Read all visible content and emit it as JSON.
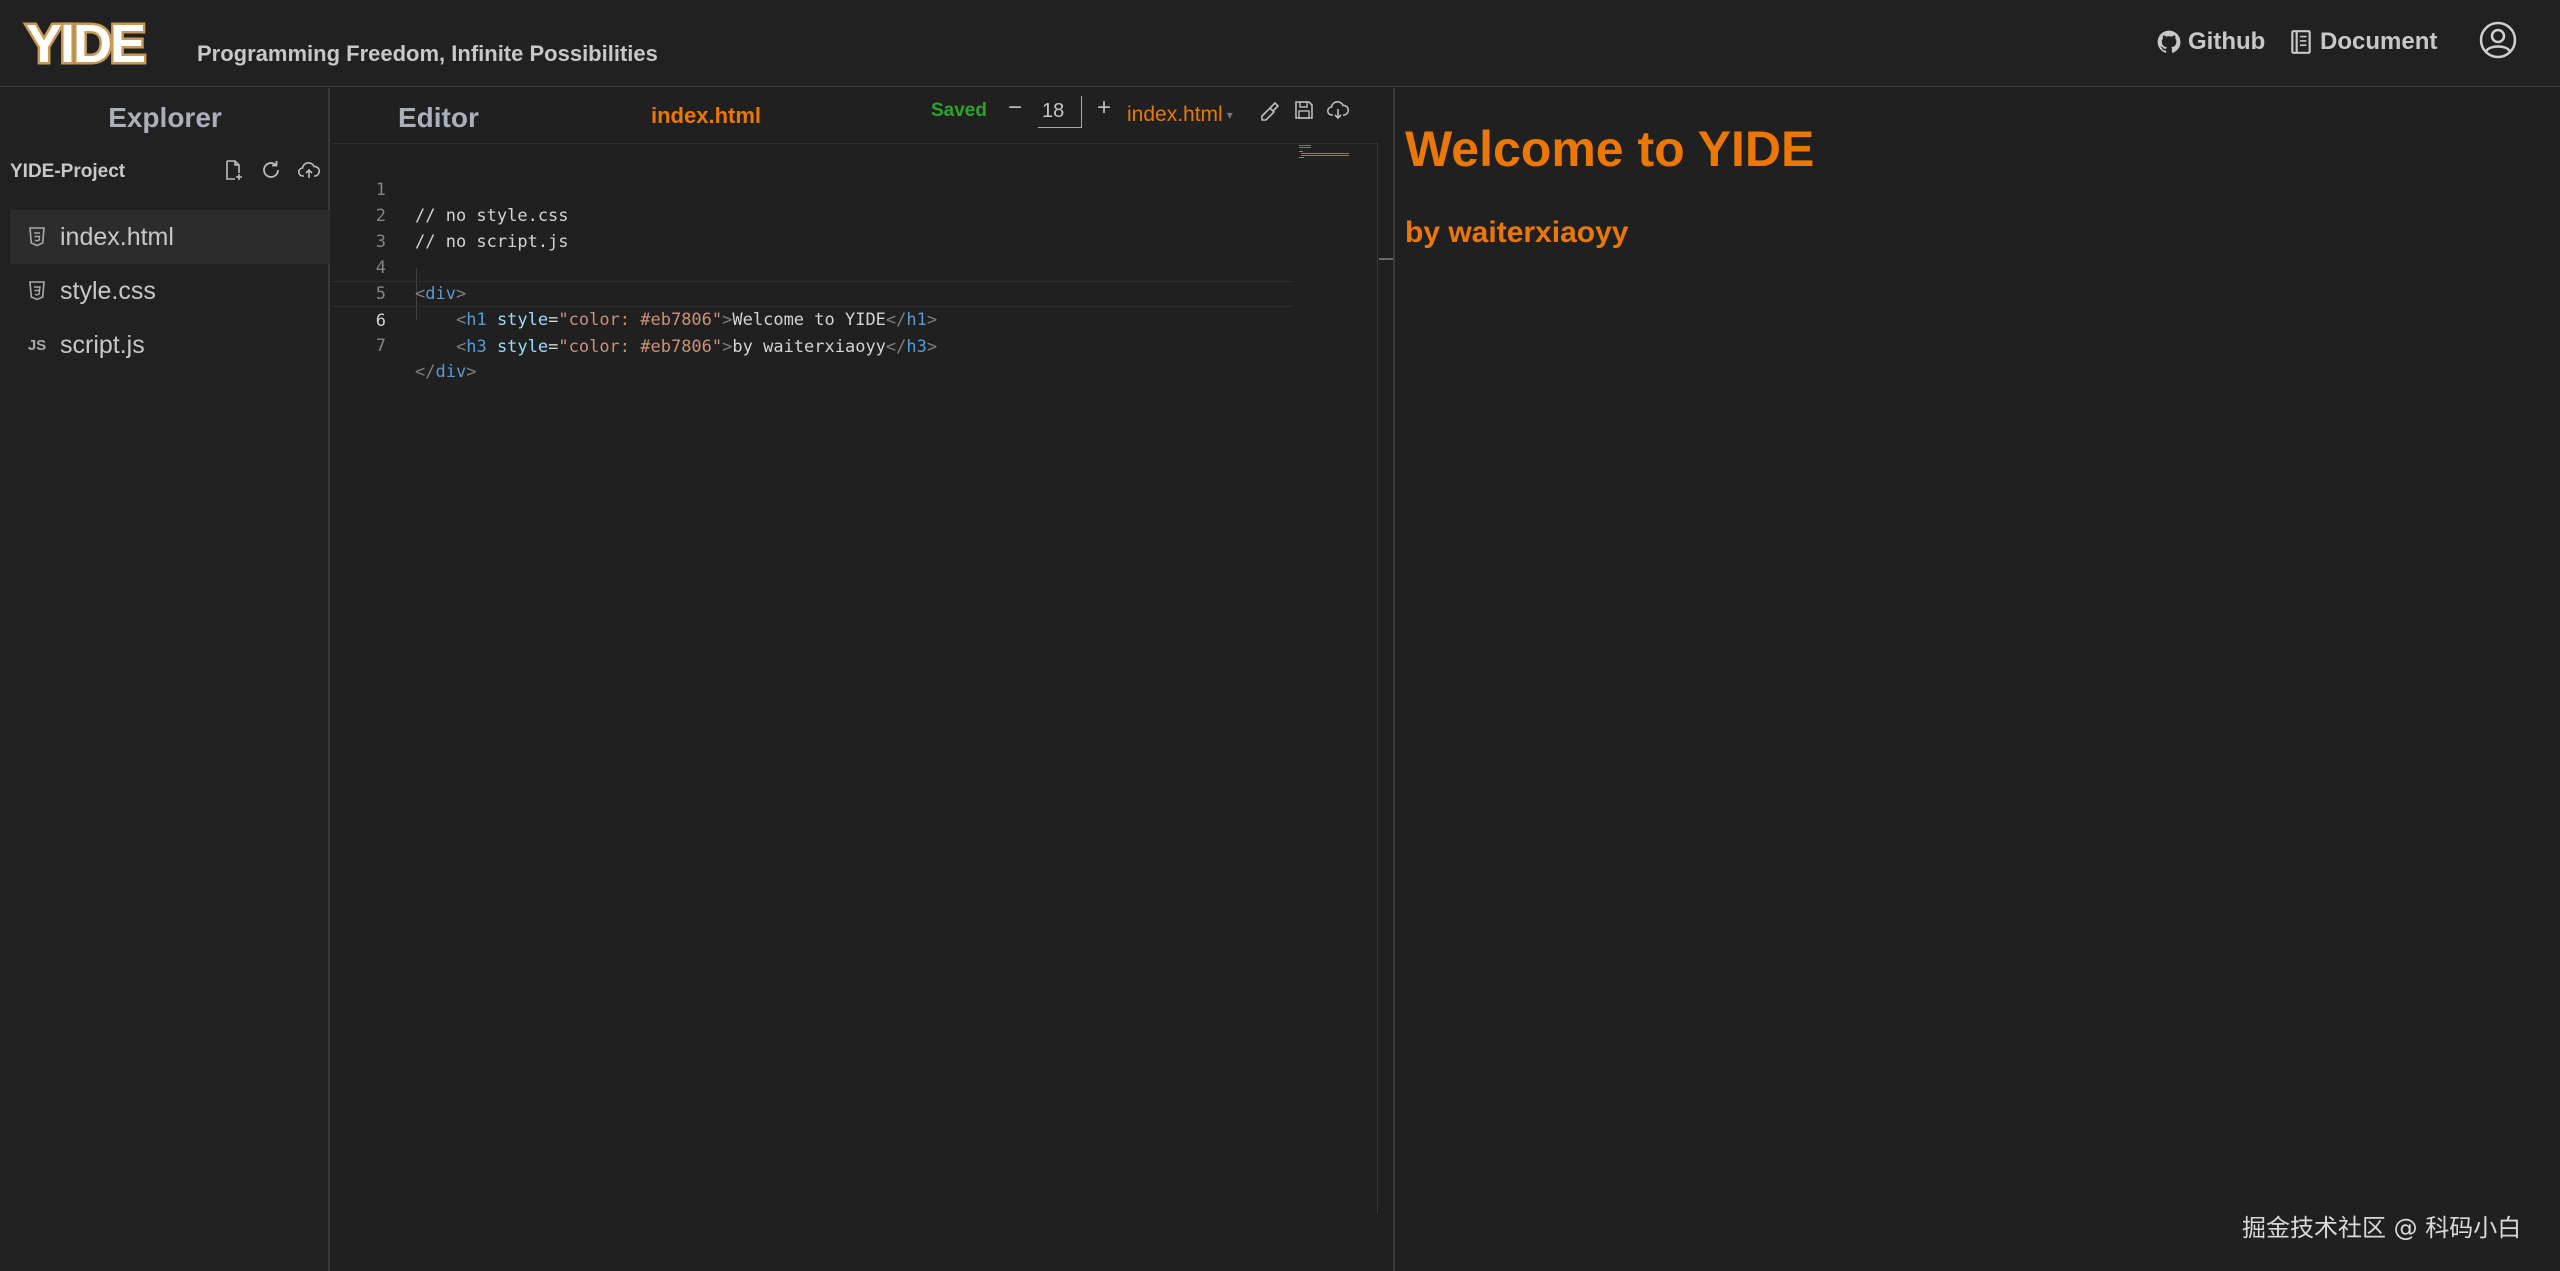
{
  "app": {
    "logo_text": "YIDE",
    "tagline": "Programming Freedom, Infinite Possibilities",
    "links": {
      "github": "Github",
      "document": "Document"
    }
  },
  "colors": {
    "accent": "#eb7806",
    "saved": "#2aa52a",
    "background": "#202020"
  },
  "explorer": {
    "title": "Explorer",
    "project_name": "YIDE-Project",
    "actions": [
      "new-file-icon",
      "refresh-icon",
      "upload-cloud-icon"
    ],
    "files": [
      {
        "name": "index.html",
        "icon": "html-icon",
        "active": true
      },
      {
        "name": "style.css",
        "icon": "css-icon",
        "active": false
      },
      {
        "name": "script.js",
        "icon": "JS",
        "active": false
      }
    ]
  },
  "editor": {
    "title": "Editor",
    "open_file": "index.html",
    "status": "Saved",
    "font_size": "18",
    "minus": "−",
    "plus": "+",
    "selected_file": "index.html",
    "current_line": 6,
    "line_numbers": [
      "1",
      "2",
      "3",
      "4",
      "5",
      "6",
      "7"
    ]
  },
  "preview": {
    "heading": "Welcome to YIDE",
    "subheading": "by waiterxiaoyy"
  },
  "watermark": "掘金技术社区 @ 科码小白"
}
